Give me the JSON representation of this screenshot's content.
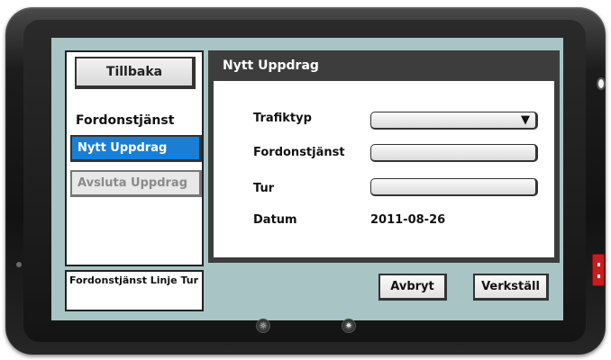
{
  "sidebar": {
    "back_label": "Tillbaka",
    "section_heading": "Fordonstjänst",
    "items": [
      {
        "label": "Nytt Uppdrag",
        "active": true
      },
      {
        "label": "Avsluta Uppdrag",
        "active": false
      }
    ],
    "status_label": "Fordonstjänst Linje Tur"
  },
  "form": {
    "title": "Nytt Uppdrag",
    "traffic_type_label": "Trafiktyp",
    "vehicle_service_label": "Fordonstjänst",
    "trip_label": "Tur",
    "date_label": "Datum",
    "date_value": "2011-08-26",
    "dropdown_arrow": "▼"
  },
  "actions": {
    "cancel_label": "Avbryt",
    "apply_label": "Verkställ"
  },
  "device": {
    "hw_left_glyph": "☼",
    "hw_right_glyph": "✷"
  },
  "colors": {
    "screen_background": "#a9c4c5",
    "active_nav": "#1a7fd4",
    "header_bar": "#3d3d3d",
    "power_switch": "#c81d1d"
  }
}
